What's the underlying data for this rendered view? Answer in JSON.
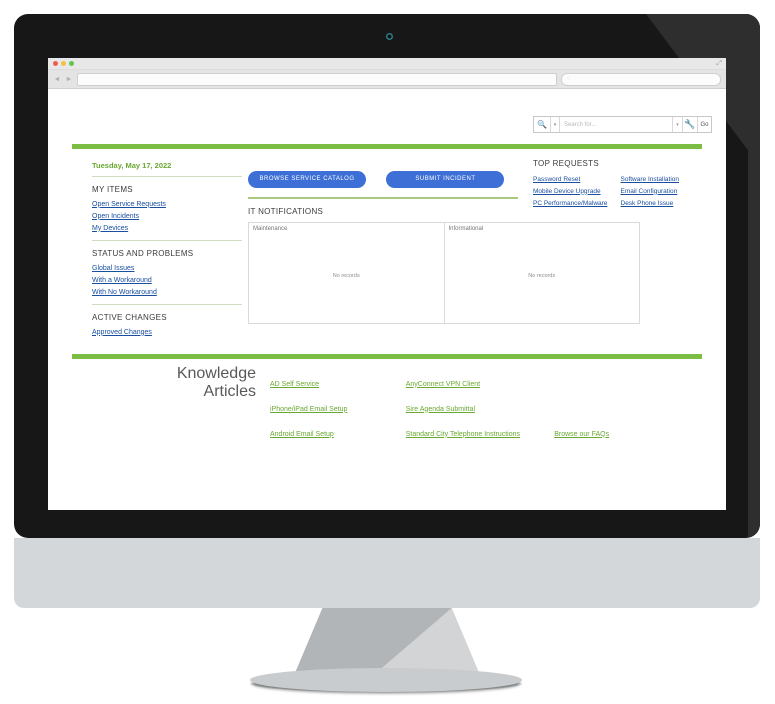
{
  "browser": {
    "url_value": "",
    "url_placeholder": "",
    "search_placeholder": "",
    "back_icon": "back-arrow-icon",
    "forward_icon": "forward-arrow-icon",
    "resize_icon": "resize-handle-icon"
  },
  "search_widget": {
    "magnifier_icon": "search-icon",
    "caret_icon": "chevron-down-icon",
    "placeholder": "Search for...",
    "value": "",
    "caret2_icon": "chevron-down-icon",
    "wrench_icon": "wrench-icon",
    "go_label": "Go"
  },
  "sidebar": {
    "date": "Tuesday, May 17, 2022",
    "groups": [
      {
        "heading": "MY ITEMS",
        "links": [
          "Open Service Requests",
          "Open Incidents",
          "My Devices"
        ]
      },
      {
        "heading": "STATUS AND PROBLEMS",
        "links": [
          "Global Issues",
          "With a Workaround",
          "With No Workaround"
        ]
      },
      {
        "heading": "ACTIVE CHANGES",
        "links": [
          "Approved Changes"
        ]
      }
    ]
  },
  "actions": {
    "browse_catalog": "BROWSE SERVICE CATALOG",
    "submit_incident": "SUBMIT INCIDENT"
  },
  "notifications": {
    "title": "IT NOTIFICATIONS",
    "columns": [
      {
        "label": "Maintenance",
        "empty": "No records"
      },
      {
        "label": "Informational",
        "empty": "No records"
      }
    ]
  },
  "top_requests": {
    "heading": "TOP REQUESTS",
    "left": [
      "Password Reset",
      "Mobile Device Upgrade",
      "PC Performance/Malware"
    ],
    "right": [
      "Software Installation",
      "Email Configuration",
      "Desk Phone Issue"
    ]
  },
  "knowledge": {
    "title_line1": "Knowledge",
    "title_line2": "Articles",
    "rows": [
      {
        "a": "AD Self Service",
        "b": "AnyConnect VPN Client",
        "c": ""
      },
      {
        "a": "iPhone/iPad Email Setup",
        "b": "Sire Agenda Submittal",
        "c": ""
      },
      {
        "a": "Android Email Setup",
        "b": "Standard City Telephone Instructions",
        "c": "Browse our FAQs"
      }
    ]
  },
  "colors": {
    "green": "#7cbe43",
    "blue_button": "#3d6fd6",
    "link_blue": "#1a4fa0",
    "link_green": "#6aa832",
    "bezel": "#171717"
  }
}
